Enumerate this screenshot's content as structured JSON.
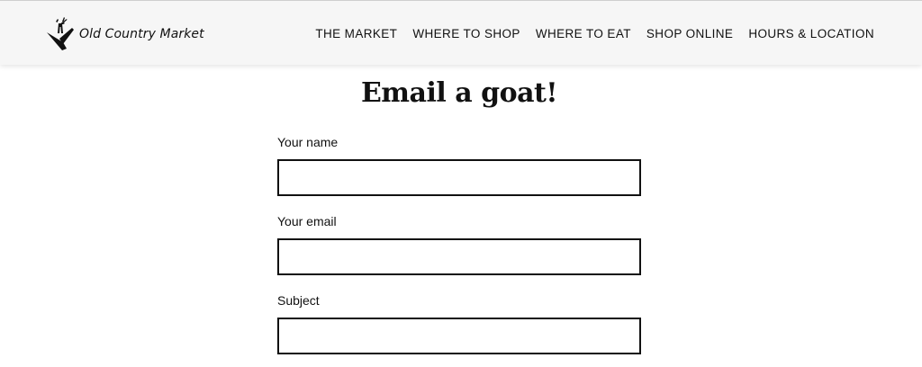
{
  "header": {
    "logo_text": "Old Country Market",
    "nav": [
      {
        "label": "THE MARKET"
      },
      {
        "label": "WHERE TO SHOP"
      },
      {
        "label": "WHERE TO EAT"
      },
      {
        "label": "SHOP ONLINE"
      },
      {
        "label": "HOURS & LOCATION"
      }
    ]
  },
  "page": {
    "title": "Email a goat!"
  },
  "form": {
    "fields": [
      {
        "label": "Your name",
        "value": "",
        "placeholder": ""
      },
      {
        "label": "Your email",
        "value": "",
        "placeholder": ""
      },
      {
        "label": "Subject",
        "value": "",
        "placeholder": ""
      }
    ]
  },
  "colors": {
    "header_bg": "#f6f6f6",
    "text": "#111111",
    "input_border": "#111111",
    "page_bg": "#ffffff"
  },
  "icons": {
    "logo": "goat-on-roof-logo-icon"
  }
}
